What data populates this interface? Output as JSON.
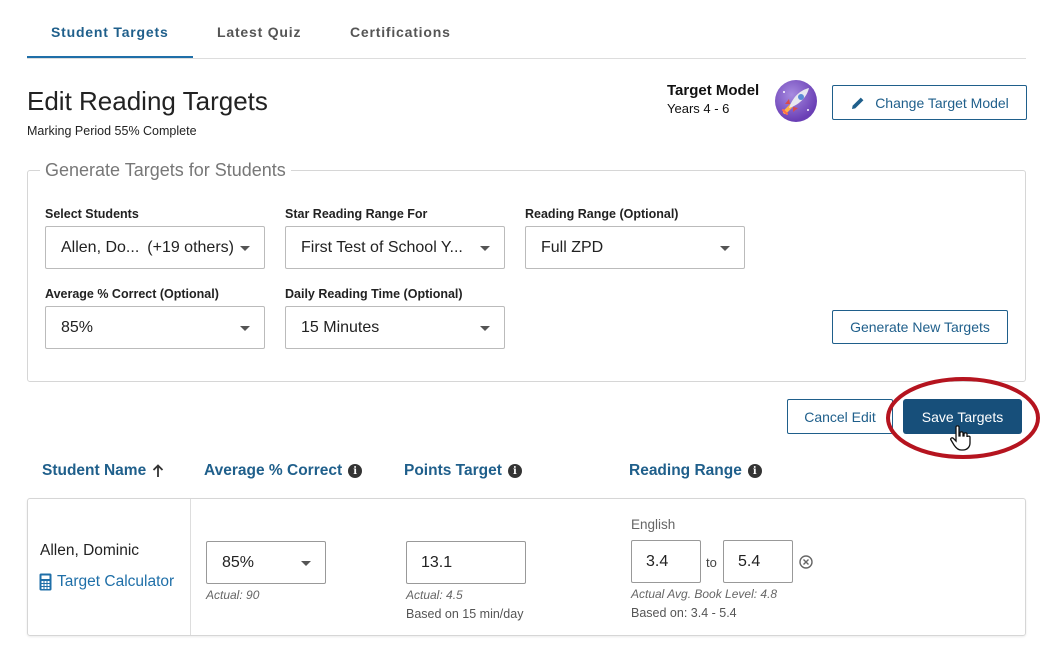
{
  "tabs": [
    {
      "label": "Student Targets"
    },
    {
      "label": "Latest Quiz"
    },
    {
      "label": "Certifications"
    }
  ],
  "header": {
    "title": "Edit Reading Targets",
    "subtitle": "Marking Period 55% Complete",
    "target_model_label": "Target Model",
    "target_model_value": "Years 4 - 6",
    "change_model_label": "Change Target Model"
  },
  "generate": {
    "legend": "Generate Targets for Students",
    "select_students_label": "Select Students",
    "select_students_value": "Allen, Do...",
    "select_students_others": "(+19 others)",
    "star_range_label": "Star Reading Range For",
    "star_range_value": "First Test of School Y...",
    "reading_range_label": "Reading Range (Optional)",
    "reading_range_value": "Full ZPD",
    "avg_correct_label": "Average % Correct (Optional)",
    "avg_correct_value": "85%",
    "daily_time_label": "Daily Reading Time (Optional)",
    "daily_time_value": "15 Minutes",
    "generate_button": "Generate New Targets"
  },
  "actions": {
    "cancel": "Cancel Edit",
    "save": "Save Targets"
  },
  "table": {
    "columns": [
      "Student Name",
      "Average % Correct",
      "Points Target",
      "Reading Range"
    ],
    "rows": [
      {
        "name": "Allen, Dominic",
        "calculator_link": "Target Calculator",
        "avg_correct": "85%",
        "avg_actual": "Actual: 90",
        "points_target": "13.1",
        "points_actual": "Actual: 4.5",
        "points_basis": "Based on 15 min/day",
        "range_language": "English",
        "range_from": "3.4",
        "range_to_word": "to",
        "range_to": "5.4",
        "range_actual": "Actual Avg. Book Level: 4.8",
        "range_basis": "Based on: 3.4 - 5.4"
      }
    ]
  },
  "colors": {
    "brand": "#1f5f8b",
    "save_button": "#174f7a",
    "highlight_ring": "#b5141f"
  }
}
